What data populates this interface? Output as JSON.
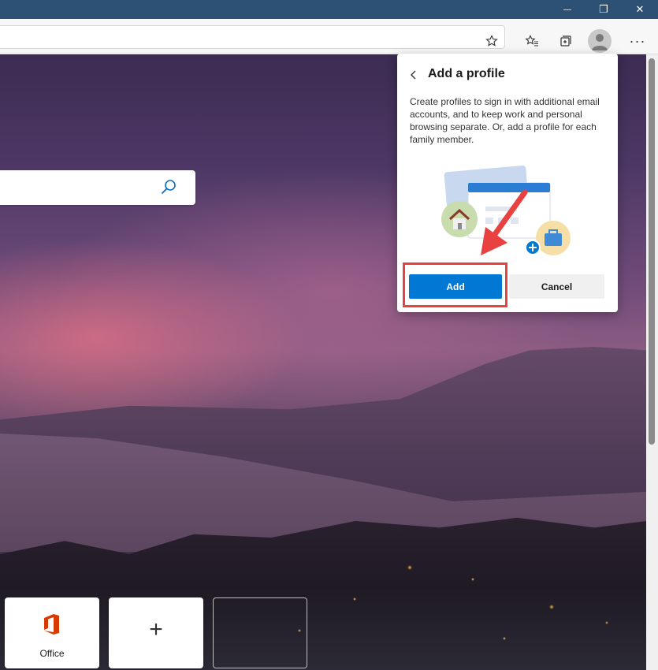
{
  "window": {
    "minimize_glyph": "—",
    "restore_glyph": "❐",
    "close_glyph": "✕"
  },
  "toolbar": {
    "more_glyph": "···"
  },
  "new_tab": {
    "tiles": [
      {
        "label": "Office"
      }
    ],
    "add_tile_glyph": "+"
  },
  "flyout": {
    "title": "Add a profile",
    "description": "Create profiles to sign in with additional email accounts, and to keep work and personal browsing separate. Or, add a profile for each family member.",
    "add_label": "Add",
    "cancel_label": "Cancel"
  },
  "colors": {
    "accent": "#0078d4",
    "annotation": "#e8413f",
    "office": "#d83b01"
  }
}
